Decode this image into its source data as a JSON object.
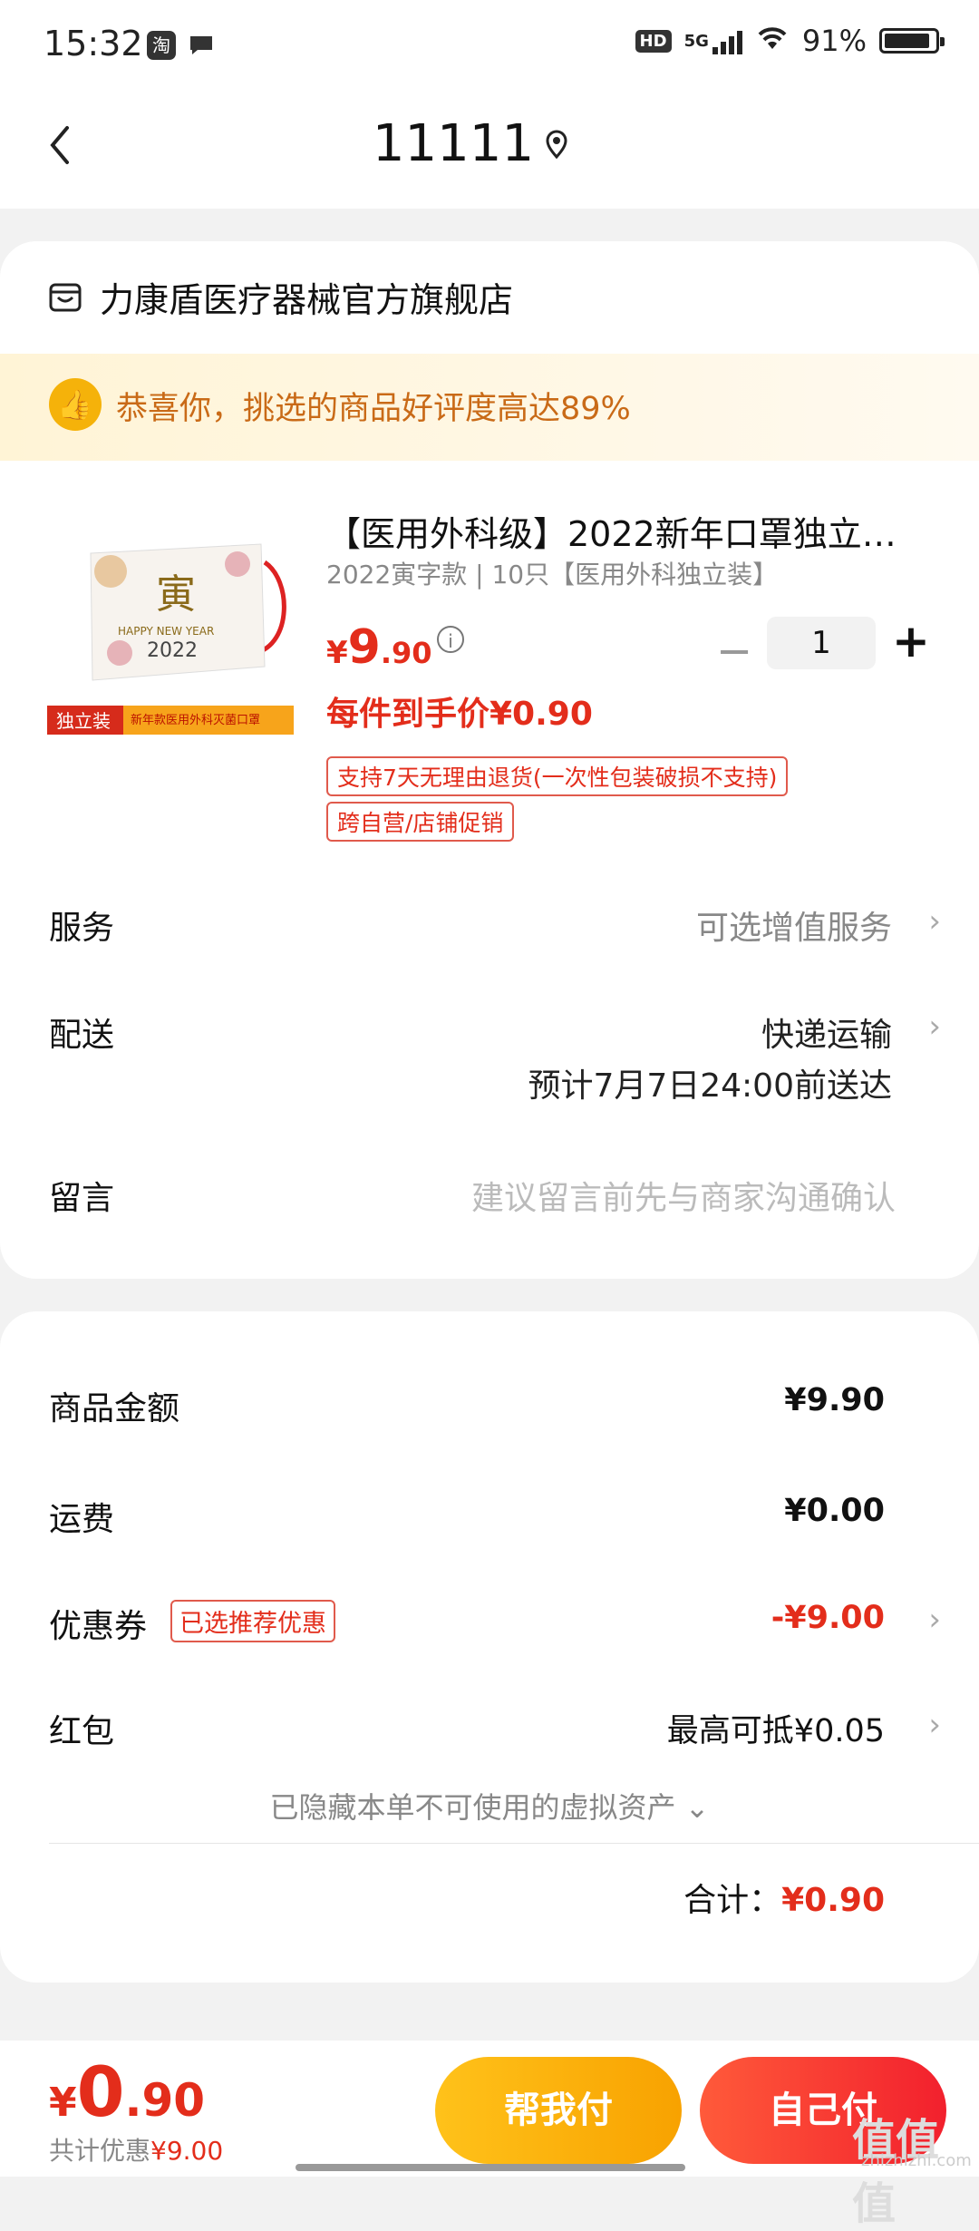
{
  "status_bar": {
    "time": "15:32",
    "app_badge_1": "淘",
    "hd": "HD",
    "network": "5G",
    "battery": "91%",
    "battery_level": 0.91
  },
  "nav": {
    "title": "11111"
  },
  "store": {
    "name": "力康盾医疗器械官方旗舰店"
  },
  "banner": {
    "text": "恭喜你，挑选的商品好评度高达89%"
  },
  "product": {
    "title": "【医用外科级】2022新年口罩独立…",
    "sku": "2022寅字款 | 10只【医用外科独立装】",
    "price_symbol": "¥",
    "price_int": "9",
    "price_dec": ".90",
    "quantity": "1",
    "unit_price": "每件到手价¥0.90",
    "tags": [
      "支持7天无理由退货(一次性包装破损不支持)",
      "跨自营/店铺促销"
    ],
    "image_text": {
      "year": "2022",
      "greeting": "HAPPY NEW YEAR",
      "badge": "独立装",
      "strip": "新年款医用外科灭菌口罩",
      "char": "寅"
    }
  },
  "service": {
    "label": "服务",
    "value": "可选增值服务"
  },
  "delivery": {
    "label": "配送",
    "value": "快递运输",
    "eta": "预计7月7日24:00前送达"
  },
  "message": {
    "label": "留言",
    "placeholder": "建议留言前先与商家沟通确认"
  },
  "summary": {
    "goods_label": "商品金额",
    "goods_value": "¥9.90",
    "shipping_label": "运费",
    "shipping_value": "¥0.00",
    "coupon_label": "优惠券",
    "coupon_tag": "已选推荐优惠",
    "coupon_value": "-¥9.00",
    "redpacket_label": "红包",
    "redpacket_value": "最高可抵¥0.05",
    "hidden_note": "已隐藏本单不可使用的虚拟资产 ⌄",
    "total_label": "合计：",
    "total_value": "¥0.90"
  },
  "bottom_bar": {
    "price_symbol": "¥",
    "price_int": "0",
    "price_dec": ".90",
    "saving_label": "共计优惠",
    "saving_value": "¥9.00",
    "help_pay_label": "帮我付",
    "self_pay_label": "自己付",
    "watermark": "值值值",
    "watermark_sub": "zhizhizhi.com"
  },
  "colors": {
    "accent_red": "#e32d1b",
    "accent_orange": "#f8a200",
    "banner_bg": "#fff4d6"
  }
}
